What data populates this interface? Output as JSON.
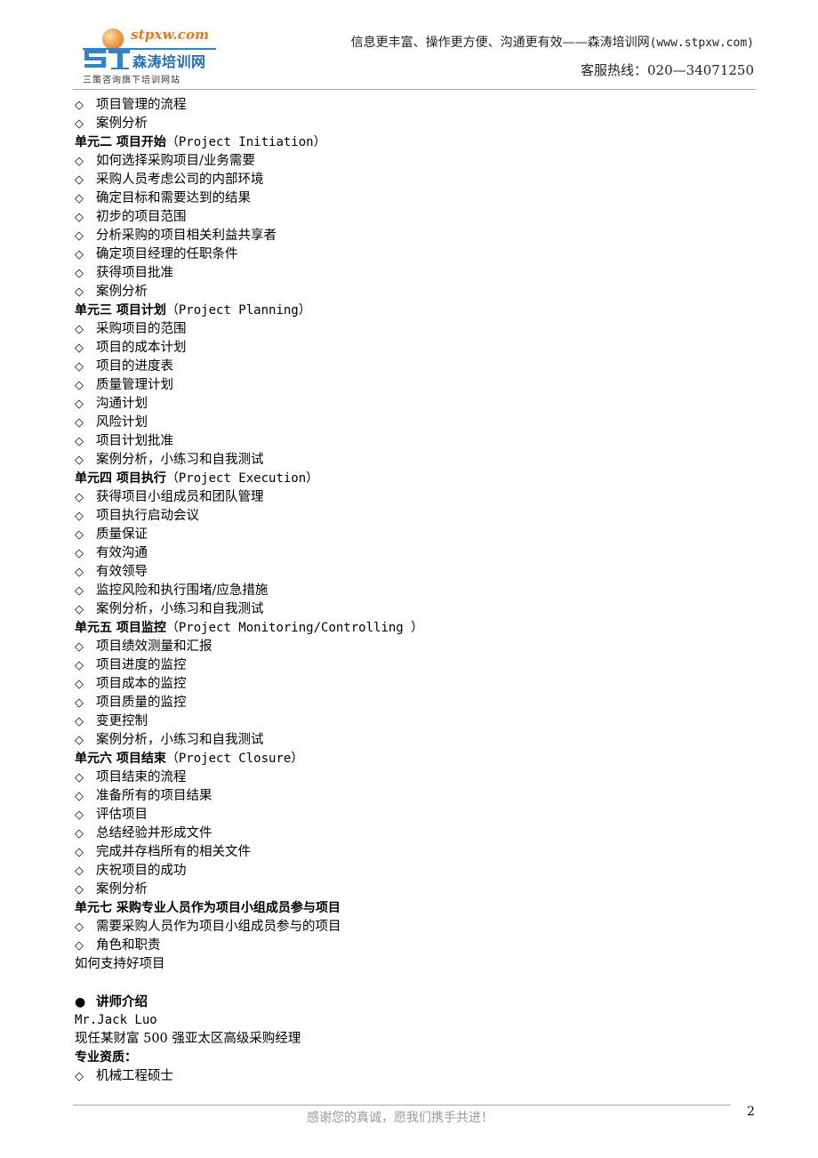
{
  "header": {
    "logo": {
      "domain": "stpxw.com",
      "mark": "ST",
      "name": "森涛培训网",
      "subtitle": "三策咨询旗下培训网站"
    },
    "slogan_cn": "信息更丰富、操作更方便、沟通更有效——森涛培训网",
    "slogan_url": "(www.stpxw.com)",
    "hotline_label": "客服热线：",
    "hotline_number": "020—34071250"
  },
  "content": [
    {
      "type": "item",
      "text": "项目管理的流程"
    },
    {
      "type": "item",
      "text": "案例分析"
    },
    {
      "type": "heading",
      "cn": "单元二 项目开始",
      "en": "（Project Initiation）"
    },
    {
      "type": "item",
      "text": "如何选择采购项目/业务需要"
    },
    {
      "type": "item",
      "text": "采购人员考虑公司的内部环境"
    },
    {
      "type": "item",
      "text": "确定目标和需要达到的结果"
    },
    {
      "type": "item",
      "text": "初步的项目范围"
    },
    {
      "type": "item",
      "text": "分析采购的项目相关利益共享者"
    },
    {
      "type": "item",
      "text": "确定项目经理的任职条件"
    },
    {
      "type": "item",
      "text": "获得项目批准"
    },
    {
      "type": "item",
      "text": "案例分析"
    },
    {
      "type": "heading",
      "cn": "单元三 项目计划",
      "en": "（Project Planning）"
    },
    {
      "type": "item",
      "text": "采购项目的范围"
    },
    {
      "type": "item",
      "text": "项目的成本计划"
    },
    {
      "type": "item",
      "text": "项目的进度表"
    },
    {
      "type": "item",
      "text": "质量管理计划"
    },
    {
      "type": "item",
      "text": "沟通计划"
    },
    {
      "type": "item",
      "text": "风险计划"
    },
    {
      "type": "item",
      "text": "项目计划批准"
    },
    {
      "type": "item",
      "text": "案例分析，小练习和自我测试"
    },
    {
      "type": "heading",
      "cn": "单元四 项目执行",
      "en": "（Project Execution）"
    },
    {
      "type": "item",
      "text": "获得项目小组成员和团队管理"
    },
    {
      "type": "item",
      "text": "项目执行启动会议"
    },
    {
      "type": "item",
      "text": "质量保证"
    },
    {
      "type": "item",
      "text": "有效沟通"
    },
    {
      "type": "item",
      "text": "有效领导"
    },
    {
      "type": "item",
      "text": "监控风险和执行围堵/应急措施"
    },
    {
      "type": "item",
      "text": "案例分析，小练习和自我测试"
    },
    {
      "type": "heading",
      "cn": "单元五 项目监控",
      "en": "（Project Monitoring/Controlling ）"
    },
    {
      "type": "item",
      "text": "项目绩效测量和汇报"
    },
    {
      "type": "item",
      "text": "项目进度的监控"
    },
    {
      "type": "item",
      "text": "项目成本的监控"
    },
    {
      "type": "item",
      "text": "项目质量的监控"
    },
    {
      "type": "item",
      "text": "变更控制"
    },
    {
      "type": "item",
      "text": "案例分析，小练习和自我测试"
    },
    {
      "type": "heading",
      "cn": "单元六 项目结束",
      "en": "（Project Closure）"
    },
    {
      "type": "item",
      "text": "项目结束的流程"
    },
    {
      "type": "item",
      "text": "准备所有的项目结果"
    },
    {
      "type": "item",
      "text": "评估项目"
    },
    {
      "type": "item",
      "text": "总结经验并形成文件"
    },
    {
      "type": "item",
      "text": "完成并存档所有的相关文件"
    },
    {
      "type": "item",
      "text": "庆祝项目的成功"
    },
    {
      "type": "item",
      "text": "案例分析"
    },
    {
      "type": "heading",
      "cn": "单元七 采购专业人员作为项目小组成员参与项目",
      "en": ""
    },
    {
      "type": "item",
      "text": "需要采购人员作为项目小组成员参与的项目"
    },
    {
      "type": "item",
      "text": "角色和职责"
    },
    {
      "type": "plain",
      "text": "如何支持好项目"
    },
    {
      "type": "blank",
      "text": ""
    },
    {
      "type": "bullet",
      "text": "讲师介绍"
    },
    {
      "type": "mono",
      "text": "Mr.Jack Luo"
    },
    {
      "type": "plain",
      "text": "现任某财富 500 强亚太区高级采购经理"
    },
    {
      "type": "heading",
      "cn": "专业资质：",
      "en": ""
    },
    {
      "type": "item",
      "text": "机械工程硕士"
    }
  ],
  "symbols": {
    "item": "◇",
    "bullet": "●"
  },
  "footer": {
    "text": "感谢您的真诚，愿我们携手共进！",
    "page_number": "2"
  }
}
